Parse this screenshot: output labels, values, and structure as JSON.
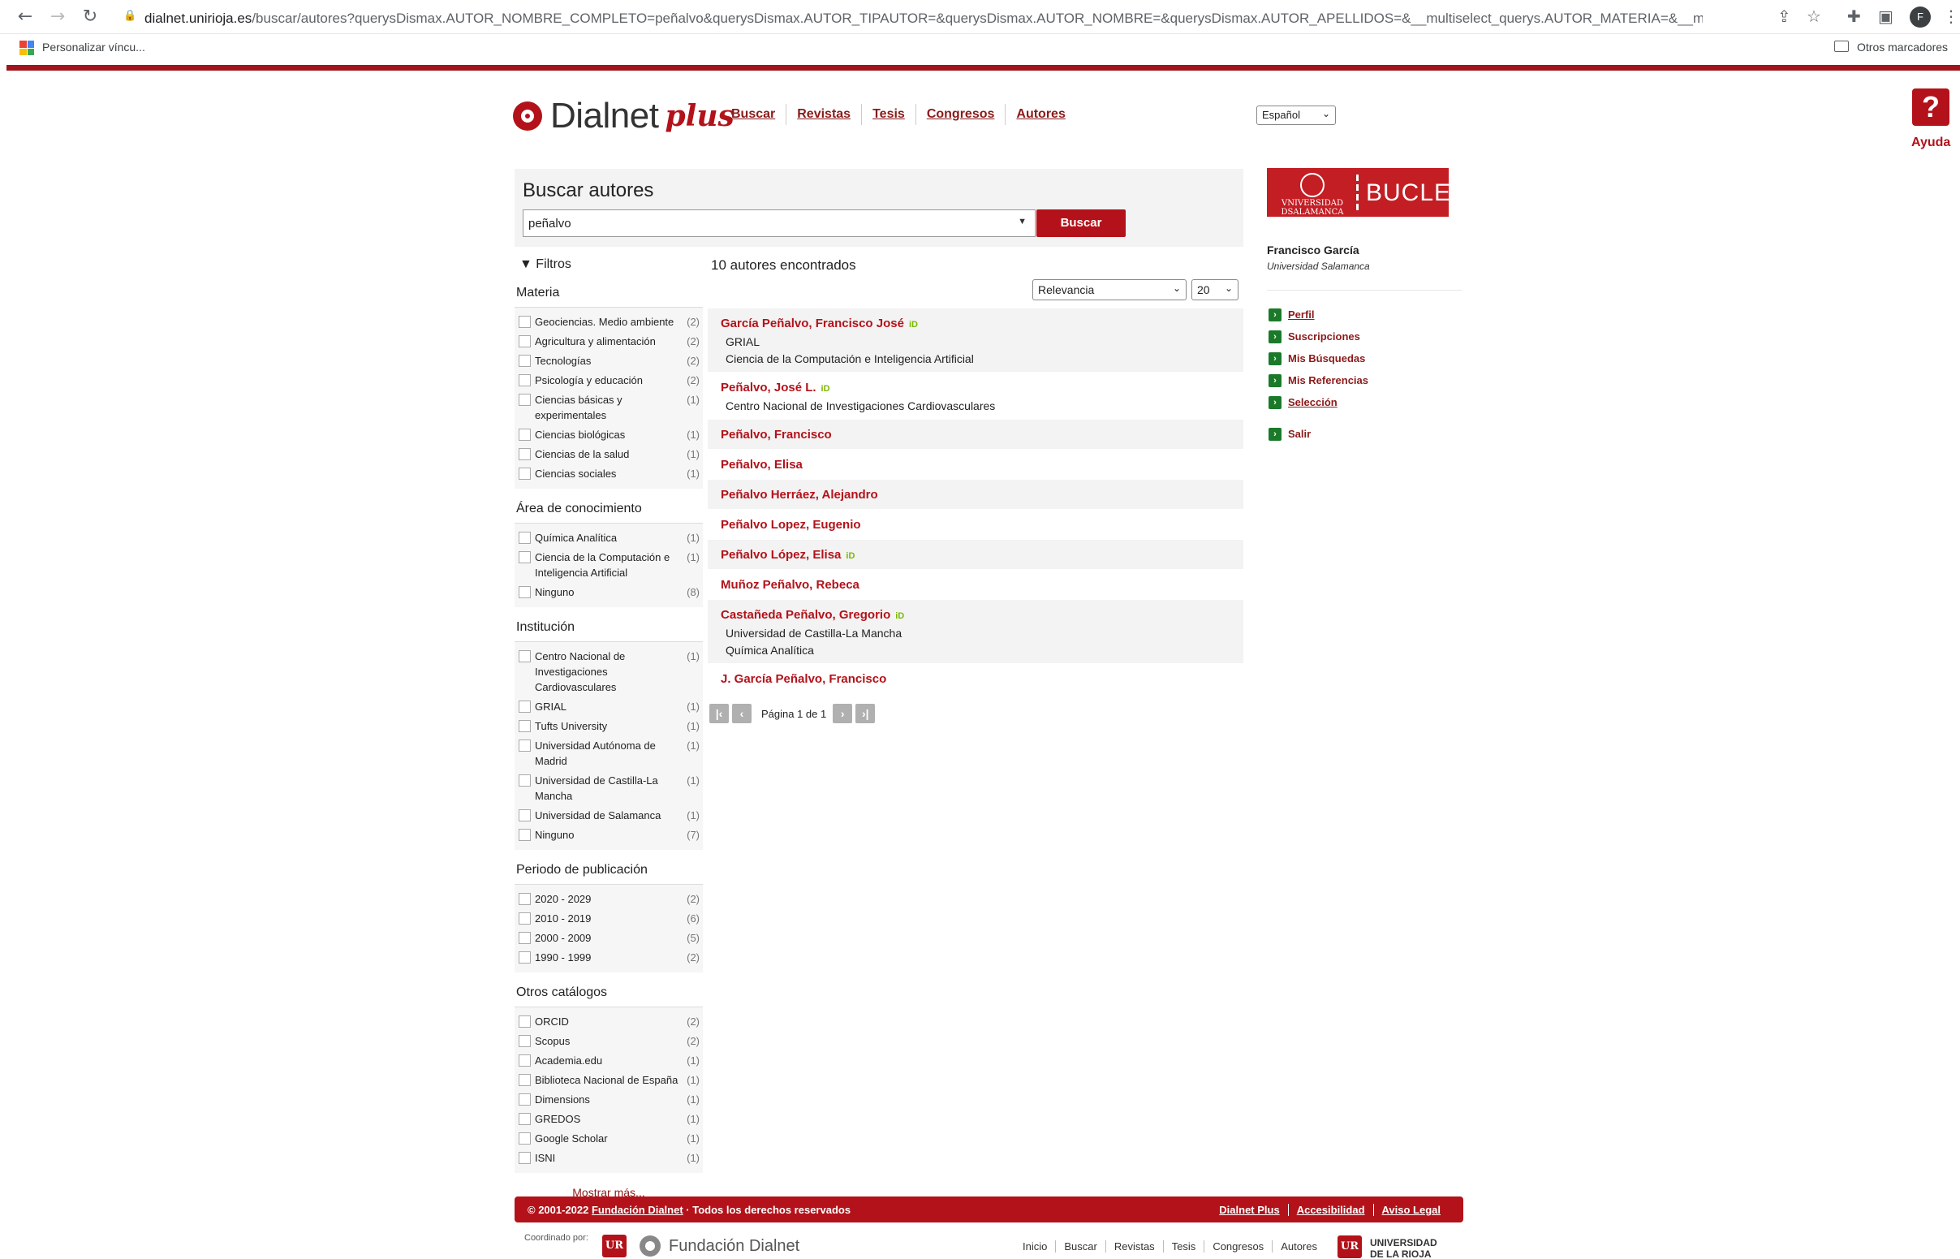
{
  "browser": {
    "url_domain": "dialnet.unirioja.es",
    "url_path": "/buscar/autores?querysDismax.AUTOR_NOMBRE_COMPLETO=peñalvo&querysDismax.AUTOR_TIPAUTOR=&querysDismax.AUTOR_NOMBRE=&querysDismax.AUTOR_APELLIDOS=&__multiselect_querys.AUTOR_MATERIA=&__mu...",
    "avatar_letter": "F",
    "bookmark_label": "Personalizar víncu...",
    "other_bookmarks": "Otros marcadores"
  },
  "header": {
    "logo_text": "Dialnet",
    "logo_plus": "plus",
    "nav": [
      {
        "label": "Buscar"
      },
      {
        "label": "Revistas"
      },
      {
        "label": "Tesis"
      },
      {
        "label": "Congresos"
      },
      {
        "label": "Autores"
      }
    ],
    "language": "Español",
    "help_symbol": "?",
    "help_label": "Ayuda"
  },
  "search": {
    "title": "Buscar autores",
    "query": "peñalvo",
    "button_label": "Buscar"
  },
  "filters": {
    "title": "Filtros",
    "groups": [
      {
        "title": "Materia",
        "items": [
          {
            "label": "Geociencias. Medio ambiente",
            "count": "(2)"
          },
          {
            "label": "Agricultura y alimentación",
            "count": "(2)"
          },
          {
            "label": "Tecnologías",
            "count": "(2)"
          },
          {
            "label": "Psicología y educación",
            "count": "(2)"
          },
          {
            "label": "Ciencias básicas y experimentales",
            "count": "(1)"
          },
          {
            "label": "Ciencias biológicas",
            "count": "(1)"
          },
          {
            "label": "Ciencias de la salud",
            "count": "(1)"
          },
          {
            "label": "Ciencias sociales",
            "count": "(1)"
          }
        ]
      },
      {
        "title": "Área de conocimiento",
        "items": [
          {
            "label": "Química Analítica",
            "count": "(1)"
          },
          {
            "label": "Ciencia de la Computación e Inteligencia Artificial",
            "count": "(1)"
          },
          {
            "label": "Ninguno",
            "count": "(8)"
          }
        ]
      },
      {
        "title": "Institución",
        "items": [
          {
            "label": "Centro Nacional de Investigaciones Cardiovasculares",
            "count": "(1)"
          },
          {
            "label": "GRIAL",
            "count": "(1)"
          },
          {
            "label": "Tufts University",
            "count": "(1)"
          },
          {
            "label": "Universidad Autónoma de Madrid",
            "count": "(1)"
          },
          {
            "label": "Universidad de Castilla-La Mancha",
            "count": "(1)"
          },
          {
            "label": "Universidad de Salamanca",
            "count": "(1)"
          },
          {
            "label": "Ninguno",
            "count": "(7)"
          }
        ]
      },
      {
        "title": "Periodo de publicación",
        "items": [
          {
            "label": "2020 - 2029",
            "count": "(2)"
          },
          {
            "label": "2010 - 2019",
            "count": "(6)"
          },
          {
            "label": "2000 - 2009",
            "count": "(5)"
          },
          {
            "label": "1990 - 1999",
            "count": "(2)"
          }
        ]
      },
      {
        "title": "Otros catálogos",
        "items": [
          {
            "label": "ORCID",
            "count": "(2)"
          },
          {
            "label": "Scopus",
            "count": "(2)"
          },
          {
            "label": "Academia.edu",
            "count": "(1)"
          },
          {
            "label": "Biblioteca Nacional de España",
            "count": "(1)"
          },
          {
            "label": "Dimensions",
            "count": "(1)"
          },
          {
            "label": "GREDOS",
            "count": "(1)"
          },
          {
            "label": "Google Scholar",
            "count": "(1)"
          },
          {
            "label": "ISNI",
            "count": "(1)"
          }
        ]
      }
    ],
    "show_more": "Mostrar más..."
  },
  "results": {
    "count_text": "10 autores encontrados",
    "sort": "Relevancia",
    "page_size": "20",
    "items": [
      {
        "name": "García Peñalvo, Francisco José",
        "orcid": true,
        "lines": [
          "GRIAL",
          "Ciencia de la Computación e Inteligencia Artificial"
        ]
      },
      {
        "name": "Peñalvo, José L.",
        "orcid": true,
        "lines": [
          "Centro Nacional de Investigaciones Cardiovasculares"
        ]
      },
      {
        "name": "Peñalvo, Francisco",
        "orcid": false,
        "lines": []
      },
      {
        "name": "Peñalvo, Elisa",
        "orcid": false,
        "lines": []
      },
      {
        "name": "Peñalvo Herráez, Alejandro",
        "orcid": false,
        "lines": []
      },
      {
        "name": "Peñalvo Lopez, Eugenio",
        "orcid": false,
        "lines": []
      },
      {
        "name": "Peñalvo López, Elisa",
        "orcid": true,
        "lines": []
      },
      {
        "name": "Muñoz Peñalvo, Rebeca",
        "orcid": false,
        "lines": []
      },
      {
        "name": "Castañeda Peñalvo, Gregorio",
        "orcid": true,
        "lines": [
          "Universidad de Castilla-La Mancha",
          "Química Analítica"
        ]
      },
      {
        "name": "J. García Peñalvo, Francisco",
        "orcid": false,
        "lines": []
      }
    ],
    "pager_text": "Página 1 de 1"
  },
  "user": {
    "logo_seal": "VNIVERSIDAD DSALAMANCA",
    "logo_text": "BUCLE",
    "name": "Francisco García",
    "org": "Universidad Salamanca",
    "menu": [
      "Perfil",
      "Suscripciones",
      "Mis Búsquedas",
      "Mis Referencias",
      "Selección"
    ],
    "logout": "Salir"
  },
  "footer": {
    "copyright_prefix": "© 2001-2022",
    "copyright_link": "Fundación Dialnet",
    "copyright_suffix": "· Todos los derechos reservados",
    "links": [
      "Dialnet Plus",
      "Accesibilidad",
      "Aviso Legal"
    ],
    "coord_label": "Coordinado por:",
    "fd_text": "Fundación Dialnet",
    "nav": [
      "Inicio",
      "Buscar",
      "Revistas",
      "Tesis",
      "Congresos",
      "Autores"
    ],
    "ur_line1": "UNIVERSIDAD",
    "ur_line2": "DE LA RIOJA",
    "ur_mark": "UR"
  },
  "colors": {
    "brand_red": "#b3121a",
    "link_red": "#8b1a1a",
    "menu_green": "#1a7a2a",
    "orcid_green": "#7ab800"
  }
}
